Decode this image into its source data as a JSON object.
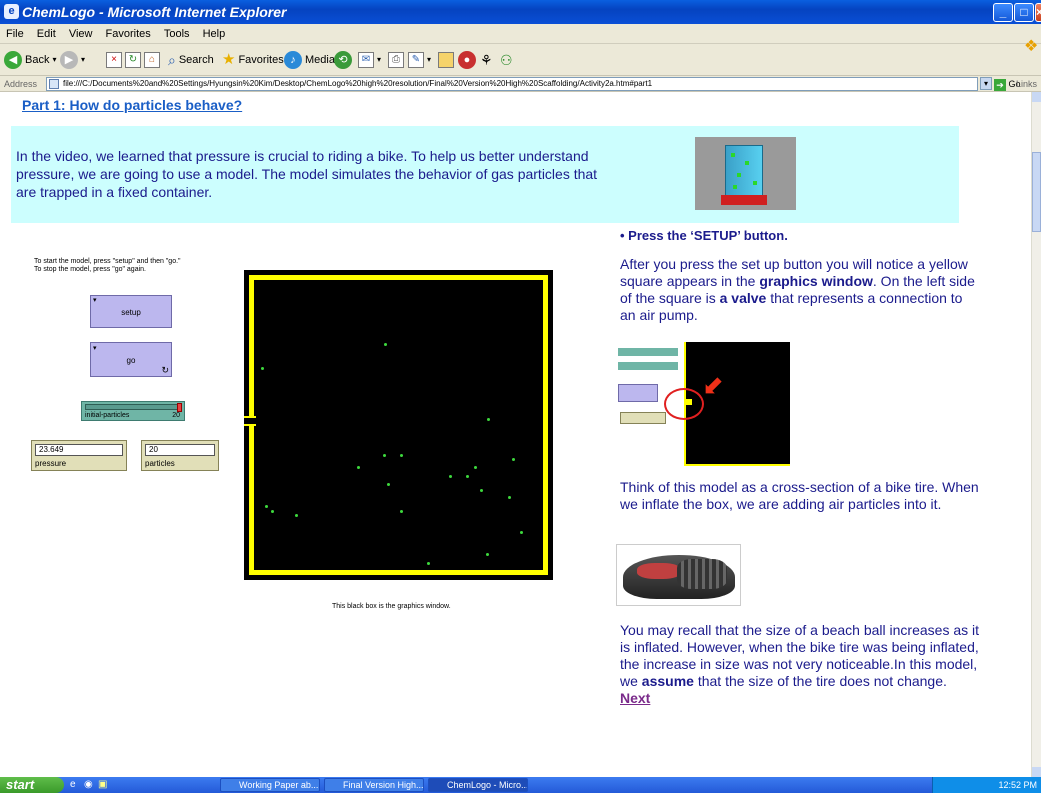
{
  "window": {
    "title": "ChemLogo - Microsoft Internet Explorer"
  },
  "menu": [
    "File",
    "Edit",
    "View",
    "Favorites",
    "Tools",
    "Help"
  ],
  "toolbar": {
    "back": "Back",
    "search": "Search",
    "favorites": "Favorites",
    "media": "Media"
  },
  "address": {
    "label": "Address",
    "url": "file:///C:/Documents%20and%20Settings/Hyungsin%20Kim/Desktop/ChemLogo%20high%20resolution/Final%20Version%20High%20Scaffolding/Activity2a.htm#part1",
    "go": "Go",
    "links": "Links"
  },
  "page": {
    "heading": "Part 1: How do particles behave?",
    "intro": "In the video, we learned that pressure is crucial to riding a bike. To help us better understand pressure, we are going to use a model. The model simulates the behavior of gas particles that are trapped in a fixed container.",
    "instructions_line1": "To start the model, press \"setup\" and then \"go.\"",
    "instructions_line2": "To stop the model, press \"go\" again.",
    "setup_label": "setup",
    "go_label": "go",
    "slider_label": "initial-particles",
    "slider_value": "20",
    "slider_fraction": 1.0,
    "pressure_value": "23.649",
    "pressure_label": "pressure",
    "particles_value": "20",
    "particles_label": "particles",
    "graphics_caption": "This black box is the graphics window.",
    "step_heading": "• Press the ‘SETUP’ button.",
    "para1_a": "After you press the set up button you will notice a yellow square appears in the ",
    "para1_b": "graphics window",
    "para1_c": ". On the left side of the square is ",
    "para1_d": "a valve",
    "para1_e": " that represents a connection to an air pump.",
    "para2": "Think of this model as a cross-section of a bike tire. When we inflate the box, we are adding air particles into it.",
    "para3_a": "You may recall that the size of a beach ball increases as it is inflated. However, when the bike tire was being inflated, the increase in size was not very noticeable.In this model, we ",
    "para3_b": "assume",
    "para3_c": " that the size of the tire does not change. ",
    "next_link": "Next"
  },
  "taskbar": {
    "start": "start",
    "tasks": [
      "Working Paper ab...",
      "Final Version High...",
      "ChemLogo - Micro..."
    ],
    "clock": "12:52 PM"
  },
  "colors": {
    "accent": "#1a5ec6",
    "text": "#1b1b8c",
    "intro_bg": "#ccfefe",
    "button": "#bcb7ee",
    "slider": "#6fb5a6",
    "particle": "#3dd83d",
    "wall": "#ffff00"
  }
}
